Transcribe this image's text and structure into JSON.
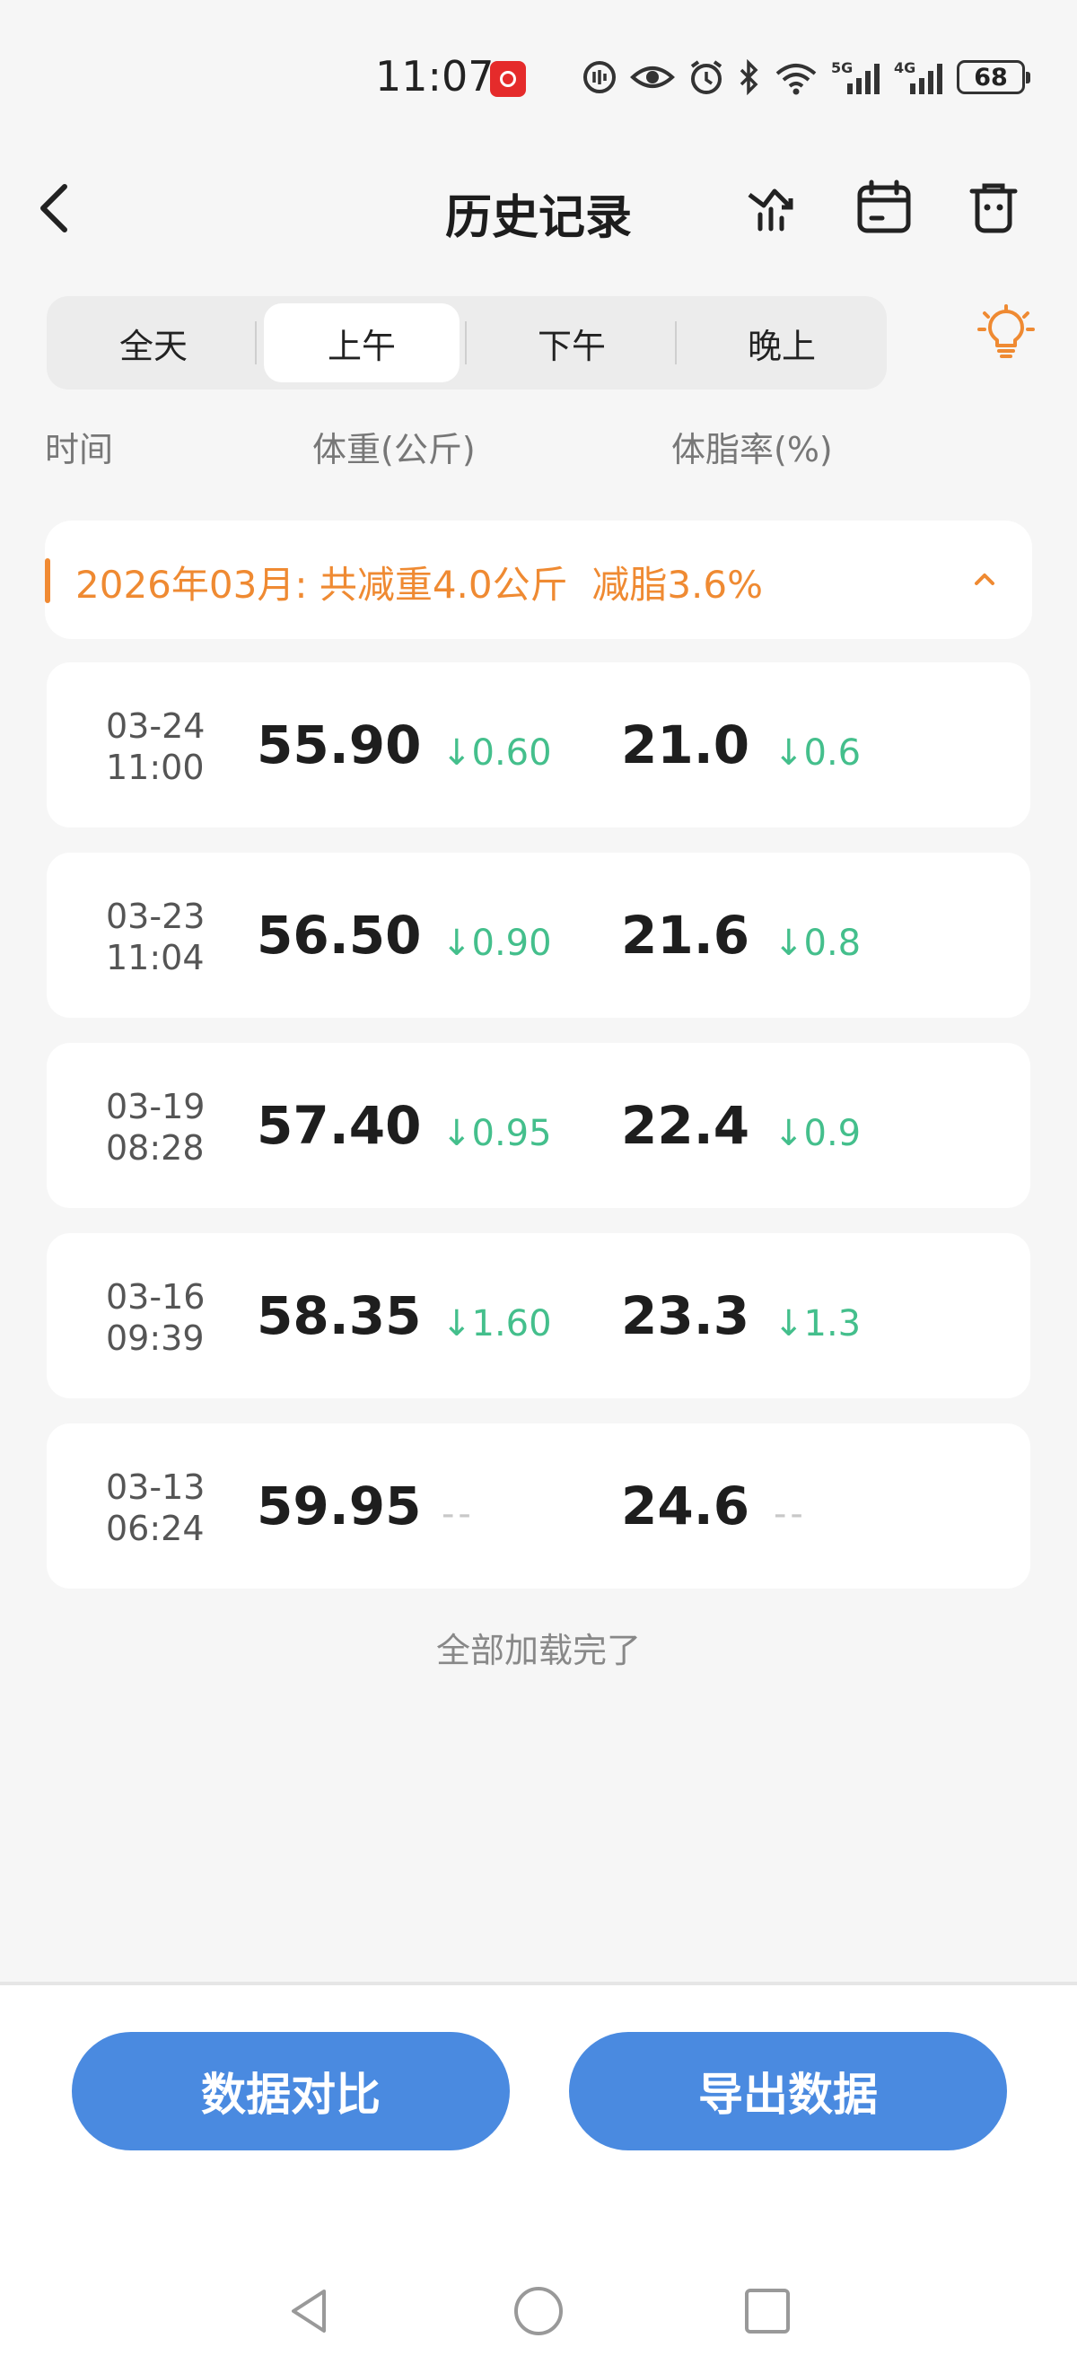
{
  "status": {
    "time": "11:07",
    "battery": "68",
    "signal_5g": "5G",
    "signal_4g": "4G",
    "wifi_label": "6"
  },
  "header": {
    "title": "历史记录"
  },
  "tabs": [
    {
      "label": "全天",
      "active": false
    },
    {
      "label": "上午",
      "active": true
    },
    {
      "label": "下午",
      "active": false
    },
    {
      "label": "晚上",
      "active": false
    }
  ],
  "columns": {
    "time": "时间",
    "weight": "体重(公斤)",
    "body_fat": "体脂率(%)"
  },
  "month_summary": {
    "text": "2026年03月: 共减重4.0公斤  减脂3.6%"
  },
  "records": [
    {
      "date": "03-24",
      "time": "11:00",
      "weight": "55.90",
      "weight_delta": "↓0.60",
      "fat": "21.0",
      "fat_delta": "↓0.6"
    },
    {
      "date": "03-23",
      "time": "11:04",
      "weight": "56.50",
      "weight_delta": "↓0.90",
      "fat": "21.6",
      "fat_delta": "↓0.8"
    },
    {
      "date": "03-19",
      "time": "08:28",
      "weight": "57.40",
      "weight_delta": "↓0.95",
      "fat": "22.4",
      "fat_delta": "↓0.9"
    },
    {
      "date": "03-16",
      "time": "09:39",
      "weight": "58.35",
      "weight_delta": "↓1.60",
      "fat": "23.3",
      "fat_delta": "↓1.3"
    },
    {
      "date": "03-13",
      "time": "06:24",
      "weight": "59.95",
      "weight_delta": "--",
      "fat": "24.6",
      "fat_delta": "--"
    }
  ],
  "footer_note": "全部加载完了",
  "buttons": {
    "compare": "数据对比",
    "export": "导出数据"
  },
  "colors": {
    "accent_blue": "#4a8ae0",
    "accent_orange": "#ef8a32",
    "decrease_green": "#44bf8c"
  },
  "icons": [
    "back-icon",
    "trend-icon",
    "calendar-icon",
    "trash-icon",
    "lightbulb-icon",
    "chevron-up-icon"
  ]
}
